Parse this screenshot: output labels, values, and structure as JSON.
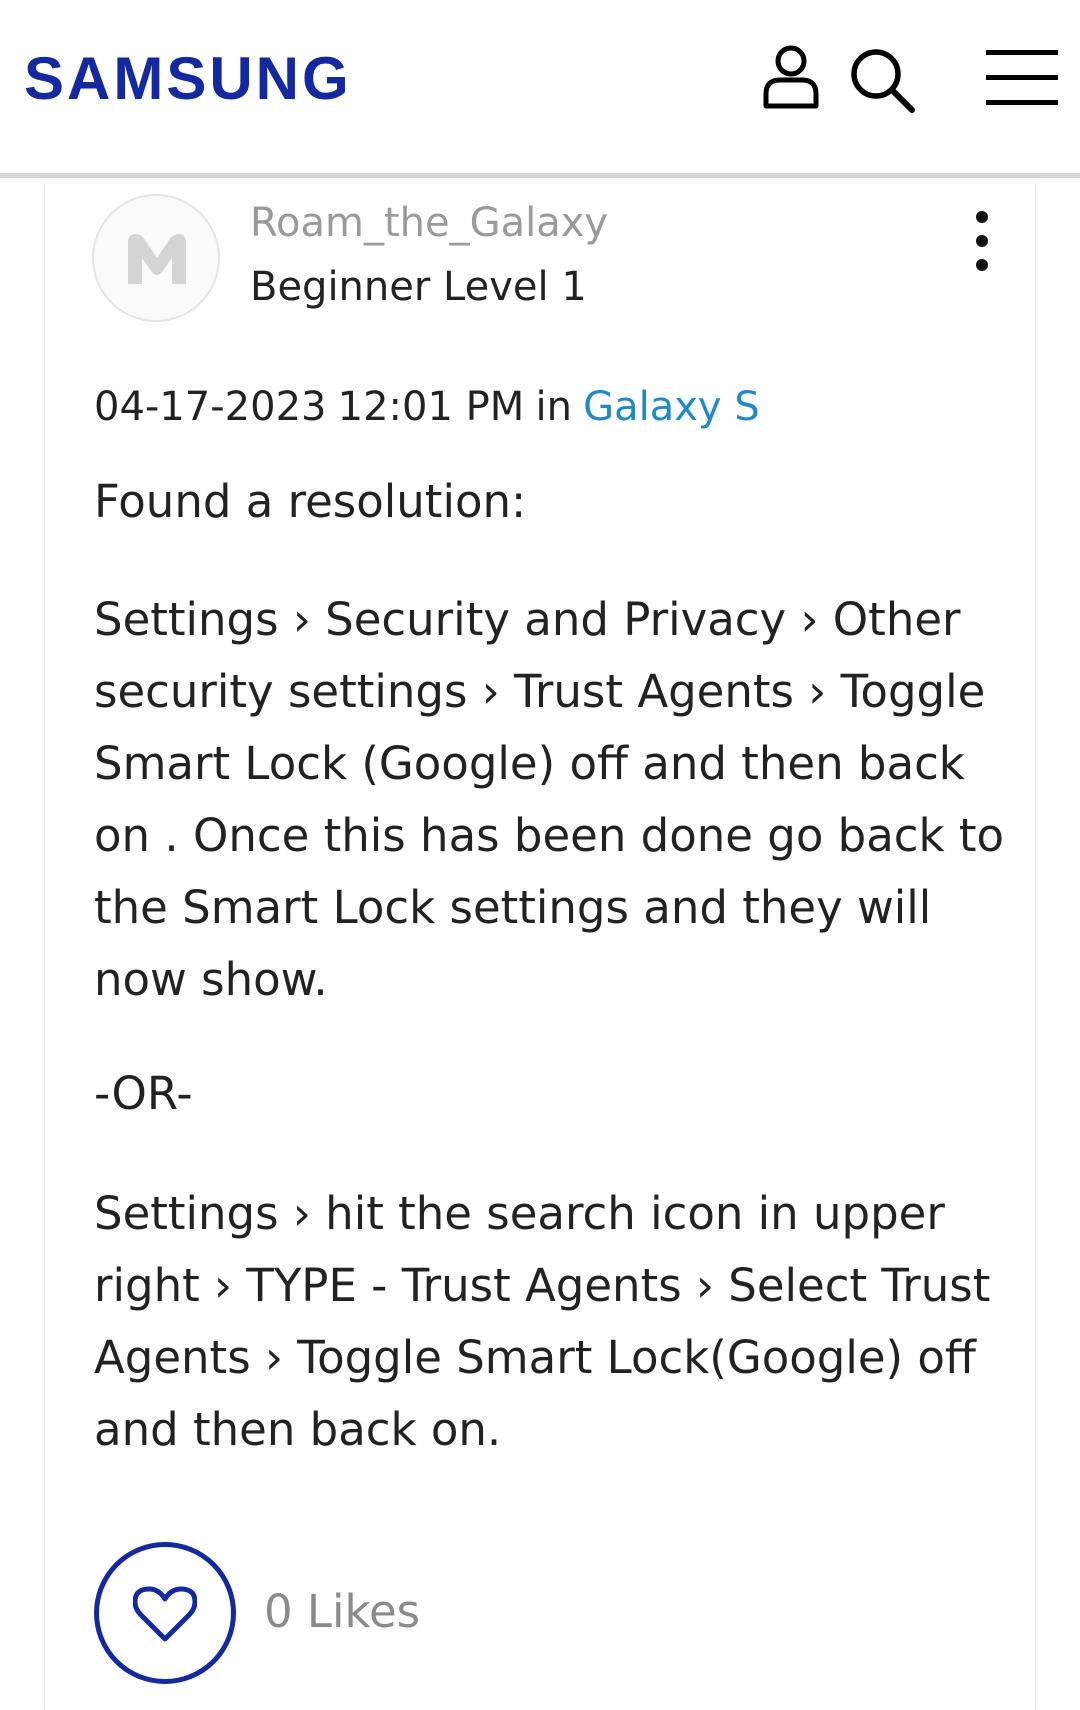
{
  "header": {
    "brand": "SAMSUNG",
    "icons": [
      "user-icon",
      "search-icon",
      "hamburger-menu-icon"
    ],
    "brand_color": "#1428a0"
  },
  "post": {
    "author": {
      "name": "Roam_the_Galaxy",
      "rank": "Beginner Level 1",
      "avatar_letter": "M"
    },
    "date": "04-17-2023",
    "time": "12:01 PM",
    "in_label": "in",
    "board": "Galaxy S",
    "body": {
      "p1": "Found a resolution:",
      "p2": "Settings › Security and Privacy › Other security settings › Trust Agents › Toggle Smart Lock (Google) off and then back on . Once this has been done go back to the Smart Lock settings and they will now show.",
      "p3": "-OR-",
      "p4": "Settings › hit the search icon in upper right › TYPE -  Trust Agents › Select Trust Agents › Toggle Smart Lock(Google) off and then back on."
    },
    "likes": "0 Likes",
    "link_color": "#2189ca"
  }
}
